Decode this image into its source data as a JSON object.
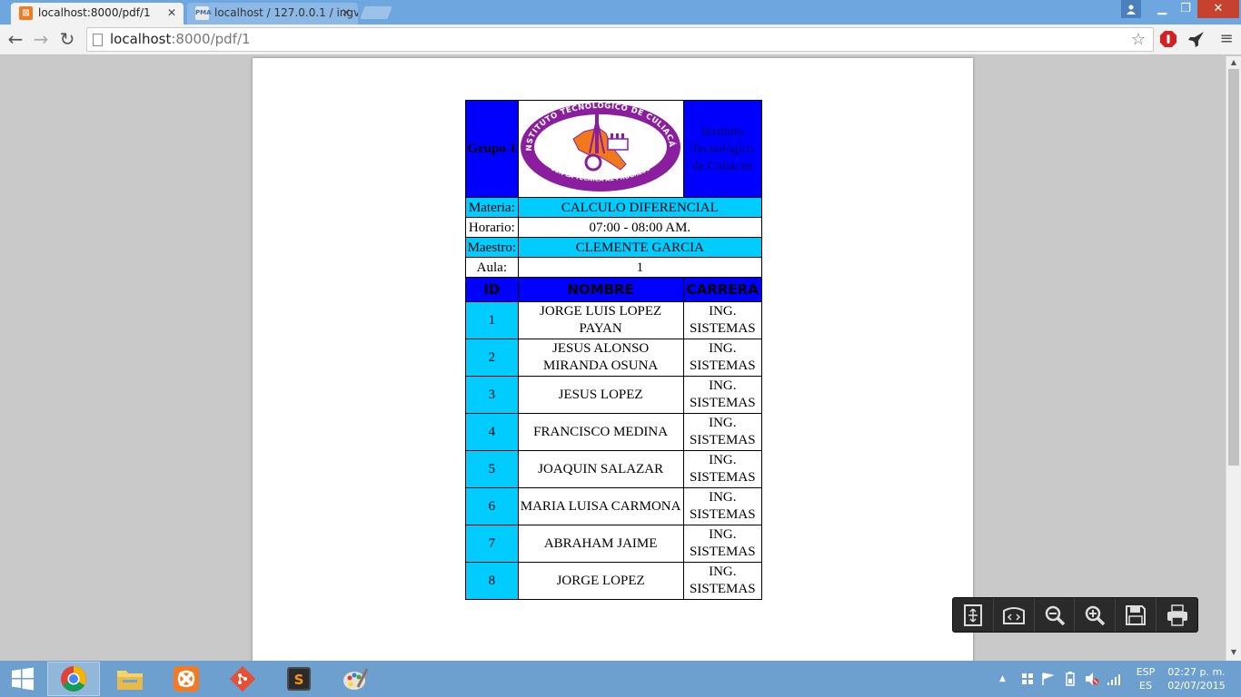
{
  "browser": {
    "tabs": [
      {
        "title": "localhost:8000/pdf/1",
        "active": true
      },
      {
        "title": "localhost / 127.0.0.1 / ingv",
        "active": false
      }
    ],
    "url_host": "localhost",
    "url_path": ":8000/pdf/1"
  },
  "report": {
    "group_label": "Grupo 1",
    "logo_top_text": "INSTITUTO TECNOLÓGICO DE CULIACÁN",
    "logo_bottom_text": "CON LA TÉCNICA AL PROGRESO",
    "institution": "Instituto Tecnológico de Culiacán",
    "info": [
      {
        "label": "Materia:",
        "value": "CALCULO DIFERENCIAL"
      },
      {
        "label": "Horario:",
        "value": "07:00 - 08:00 AM."
      },
      {
        "label": "Maestro:",
        "value": "CLEMENTE GARCIA"
      },
      {
        "label": "Aula:",
        "value": "1"
      }
    ],
    "columns": [
      "ID",
      "NOMBRE",
      "CARRERA"
    ],
    "students": [
      {
        "id": "1",
        "name": "JORGE LUIS LOPEZ PAYAN",
        "career": "ING. SISTEMAS"
      },
      {
        "id": "2",
        "name": "JESUS ALONSO MIRANDA OSUNA",
        "career": "ING. SISTEMAS"
      },
      {
        "id": "3",
        "name": "JESUS LOPEZ",
        "career": "ING. SISTEMAS"
      },
      {
        "id": "4",
        "name": "FRANCISCO MEDINA",
        "career": "ING. SISTEMAS"
      },
      {
        "id": "5",
        "name": "JOAQUIN SALAZAR",
        "career": "ING. SISTEMAS"
      },
      {
        "id": "6",
        "name": "MARIA LUISA CARMONA",
        "career": "ING. SISTEMAS"
      },
      {
        "id": "7",
        "name": "ABRAHAM JAIME",
        "career": "ING. SISTEMAS"
      },
      {
        "id": "8",
        "name": "JORGE LOPEZ",
        "career": "ING. SISTEMAS"
      }
    ]
  },
  "pdf_controls": [
    "fit-page-icon",
    "previous-next-icon",
    "zoom-out-icon",
    "zoom-in-icon",
    "save-icon",
    "print-icon"
  ],
  "taskbar": {
    "language": "ESP",
    "layout": "ES",
    "time": "02:27 p. m.",
    "date": "02/07/2015"
  },
  "colors": {
    "header_blue": "#0000ff",
    "cell_cyan": "#00ccff",
    "logo_purple": "#8b1e9e",
    "logo_orange": "#f07a1a"
  }
}
